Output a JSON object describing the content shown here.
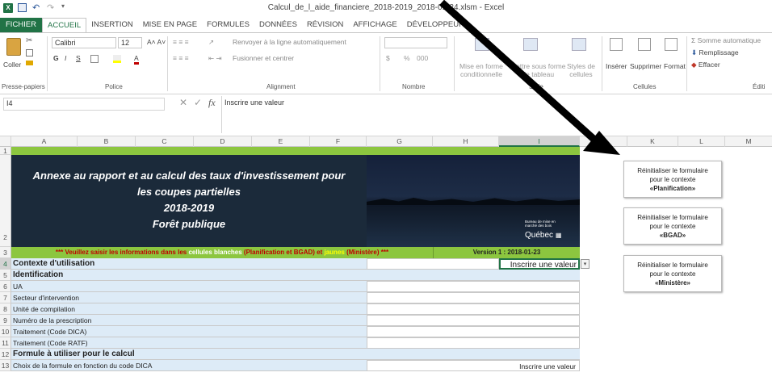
{
  "window": {
    "title": "Calcul_de_l_aide_financiere_2018-2019_2018-01-24.xlsm - Excel"
  },
  "tabs": [
    "FICHIER",
    "ACCUEIL",
    "INSERTION",
    "MISE EN PAGE",
    "FORMULES",
    "DONNÉES",
    "RÉVISION",
    "AFFICHAGE",
    "DÉVELOPPEUR"
  ],
  "ribbon": {
    "clipboard": {
      "paste": "Coller",
      "group": "Presse-papiers"
    },
    "font": {
      "name": "Calibri",
      "size": "12",
      "group": "Police",
      "bold": "G",
      "italic": "I",
      "underline": "S"
    },
    "alignment": {
      "wrap": "Renvoyer à la ligne automatiquement",
      "merge": "Fusionner et centrer",
      "group": "Alignment"
    },
    "number": {
      "format": "",
      "currency": "$",
      "percent": "%",
      "thousands": "000",
      "group": "Nombre"
    },
    "styles": {
      "conditional_1": "Mise en forme",
      "conditional_2": "conditionnelle",
      "table_1": "Mettre sous forme",
      "table_2": "de tableau",
      "cell_1": "Styles de",
      "cell_2": "cellules",
      "group": "Style"
    },
    "cells": {
      "insert": "Insérer",
      "delete": "Supprimer",
      "format": "Format",
      "group": "Cellules"
    },
    "editing": {
      "autosum": "Somme automatique",
      "fill": "Remplissage",
      "clear": "Effacer",
      "group": "Éditi"
    }
  },
  "formula_bar": {
    "name_box": "I4",
    "fx": "fx",
    "content": "Inscrire une valeur"
  },
  "columns": [
    "A",
    "B",
    "C",
    "D",
    "E",
    "F",
    "G",
    "H",
    "I",
    "K",
    "L",
    "M"
  ],
  "rows": [
    "1",
    "2",
    "3",
    "4",
    "5",
    "6",
    "7",
    "8",
    "9",
    "10",
    "11",
    "12",
    "13"
  ],
  "banner": {
    "line1": "Annexe au rapport et au calcul des taux d'investissement pour",
    "line2": "les coupes partielles",
    "line3": "2018-2019",
    "line4": "Forêt publique"
  },
  "logo": {
    "text": "Bureau de mise en marché des bois",
    "name": "Québec"
  },
  "row3": {
    "prefix": "*** Veuillez saisir les informations dans les ",
    "white": "cellules blanches",
    "mid": " (Planification et BGAD) et ",
    "yellow": "jaunes",
    "suffix": " (Ministère) ***",
    "version": "Version 1 : 2018-01-23"
  },
  "sheet": {
    "r4_label": "Contexte d'utilisation",
    "r4_value": "Inscrire une valeur",
    "r5": "Identification",
    "r6": "UA",
    "r7": "Secteur d'intervention",
    "r8": "Unité de compilation",
    "r9": "Numéro de la prescription",
    "r10": "Traitement (Code DICA)",
    "r11": "Traitement (Code RATF)",
    "r12": "Formule à utiliser pour le calcul",
    "r13": "Choix de la formule en fonction du code DICA",
    "r13_value": "Inscrire une valeur"
  },
  "buttons": [
    {
      "line1": "Réinitialiser le formulaire",
      "line2": "pour le contexte",
      "line3": "«Planification»"
    },
    {
      "line1": "Réinitialiser le formulaire",
      "line2": "pour le contexte",
      "line3": "«BGAD»"
    },
    {
      "line1": "Réinitialiser le formulaire",
      "line2": "pour le contexte",
      "line3": "«Ministère»"
    }
  ],
  "colors": {
    "excel_green": "#217346",
    "banner": "#1b2a3a",
    "banner_bar": "#8cc63f",
    "header_row": "#ddebf7",
    "row3_bg": "#8cc63f"
  }
}
